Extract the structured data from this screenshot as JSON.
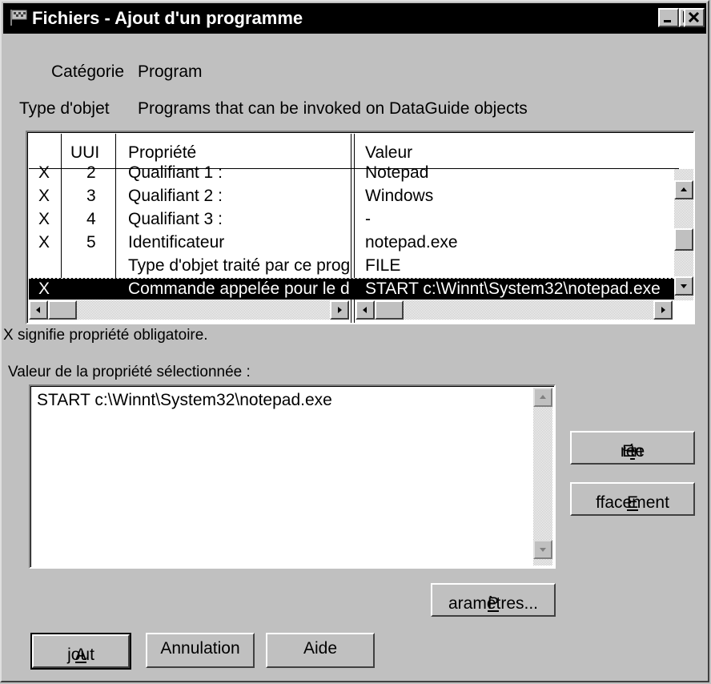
{
  "window": {
    "title": "Fichiers - Ajout d'un programme",
    "icon": "flag-icon",
    "controls": [
      "minimize-icon",
      "maximize-icon",
      "close-icon"
    ]
  },
  "category": {
    "label": "Catégorie",
    "value": "Program"
  },
  "object_type": {
    "label": "Type d'objet",
    "value": "Programs that can be invoked on DataGuide objects"
  },
  "table": {
    "headers": {
      "mandatory": "",
      "uui": "UUI",
      "property": "Propriété",
      "value": "Valeur"
    },
    "rows": [
      {
        "mandatory": "X",
        "uui": "2",
        "property": "Qualifiant 1 :",
        "value": "Notepad"
      },
      {
        "mandatory": "X",
        "uui": "3",
        "property": "Qualifiant 2 :",
        "value": "Windows"
      },
      {
        "mandatory": "X",
        "uui": "4",
        "property": "Qualifiant 3 :",
        "value": "-"
      },
      {
        "mandatory": "X",
        "uui": "5",
        "property": "Identificateur",
        "value": "notepad.exe"
      },
      {
        "mandatory": "",
        "uui": "",
        "property": "Type d'objet traité par ce prog",
        "value": "FILE"
      },
      {
        "mandatory": "X",
        "uui": "",
        "property": "Commande appelée pour le d",
        "value": "START c:\\Winnt\\System32\\notepad.exe",
        "selected": true
      }
    ]
  },
  "legend_note": "X signifie propriété obligatoire.",
  "selected_value": {
    "label": "Valeur de la propriété sélectionnée :",
    "value": "START c:\\Winnt\\System32\\notepad.exe"
  },
  "buttons": {
    "entree": {
      "pre": "En",
      "accel": "t",
      "post": "rée"
    },
    "effacement": {
      "pre": "",
      "accel": "E",
      "post": "ffacement"
    },
    "parametres": {
      "pre": "",
      "accel": "P",
      "post": "aramètres..."
    },
    "ajout": {
      "pre": "",
      "accel": "A",
      "post": "jout"
    },
    "annulation": "Annulation",
    "aide": "Aide"
  },
  "colors": {
    "titlebar": "#000000",
    "face": "#c0c0c0",
    "selection": "#000000"
  }
}
